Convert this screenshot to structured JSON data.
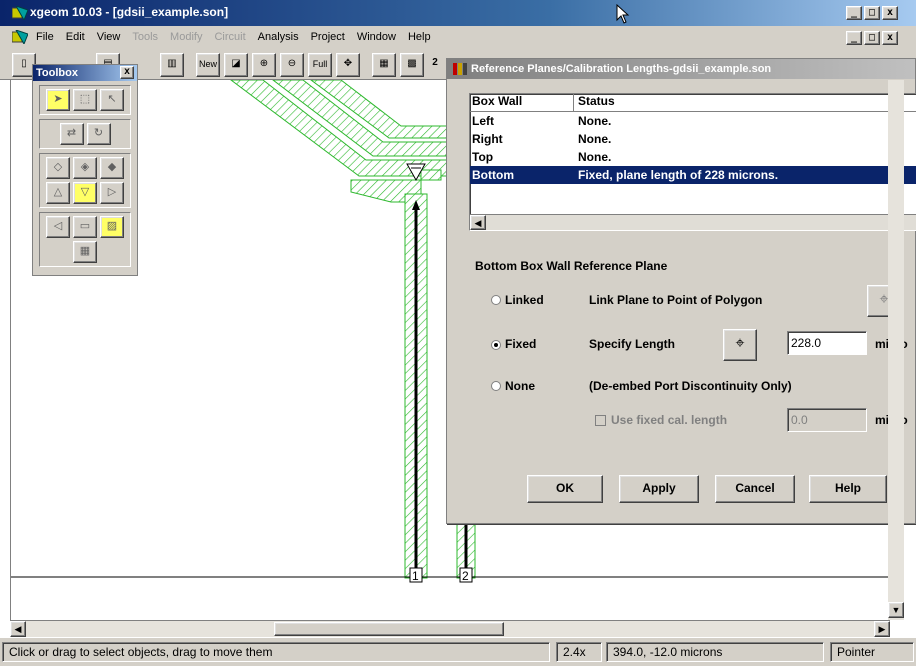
{
  "window": {
    "title": "xgeom 10.03 - [gdsii_example.son]",
    "controls": [
      "_",
      "□",
      "x"
    ]
  },
  "menu": {
    "items": [
      {
        "label": "File",
        "disabled": false
      },
      {
        "label": "Edit",
        "disabled": false
      },
      {
        "label": "View",
        "disabled": false
      },
      {
        "label": "Tools",
        "disabled": true
      },
      {
        "label": "Modify",
        "disabled": true
      },
      {
        "label": "Circuit",
        "disabled": true
      },
      {
        "label": "Analysis",
        "disabled": false
      },
      {
        "label": "Project",
        "disabled": false
      },
      {
        "label": "Window",
        "disabled": false
      },
      {
        "label": "Help",
        "disabled": false
      }
    ]
  },
  "toolbar": {
    "new_label": "New",
    "full_label": "Full",
    "level_value": "2"
  },
  "toolbox": {
    "title": "Toolbox",
    "close": "x"
  },
  "canvas": {
    "port1": "1",
    "port2": "2"
  },
  "dialog": {
    "title": "Reference Planes/Calibration Lengths-gdsii_example.son",
    "table": {
      "headers": [
        "Box Wall",
        "Status"
      ],
      "rows": [
        {
          "wall": "Left",
          "status": "None.",
          "selected": false
        },
        {
          "wall": "Right",
          "status": "None.",
          "selected": false
        },
        {
          "wall": "Top",
          "status": "None.",
          "selected": false
        },
        {
          "wall": "Bottom",
          "status": "Fixed, plane length of 228 microns.",
          "selected": true
        }
      ]
    },
    "section_title": "Bottom Box Wall Reference Plane",
    "options": {
      "linked_label": "Linked",
      "linked_desc": "Link Plane to Point of Polygon",
      "fixed_label": "Fixed",
      "fixed_desc": "Specify Length",
      "fixed_value": "228.0",
      "fixed_unit": "micro",
      "none_label": "None",
      "none_desc": "(De-embed Port Discontinuity Only)",
      "use_fixed_label": "Use fixed cal. length",
      "use_fixed_value": "0.0",
      "use_fixed_unit": "micro",
      "selected": "Fixed"
    },
    "buttons": {
      "ok": "OK",
      "apply": "Apply",
      "cancel": "Cancel",
      "help": "Help"
    }
  },
  "status": {
    "message": "Click or drag to select objects, drag to move them",
    "zoom": "2.4x",
    "coords": "394.0, -12.0 microns",
    "mode": "Pointer"
  }
}
